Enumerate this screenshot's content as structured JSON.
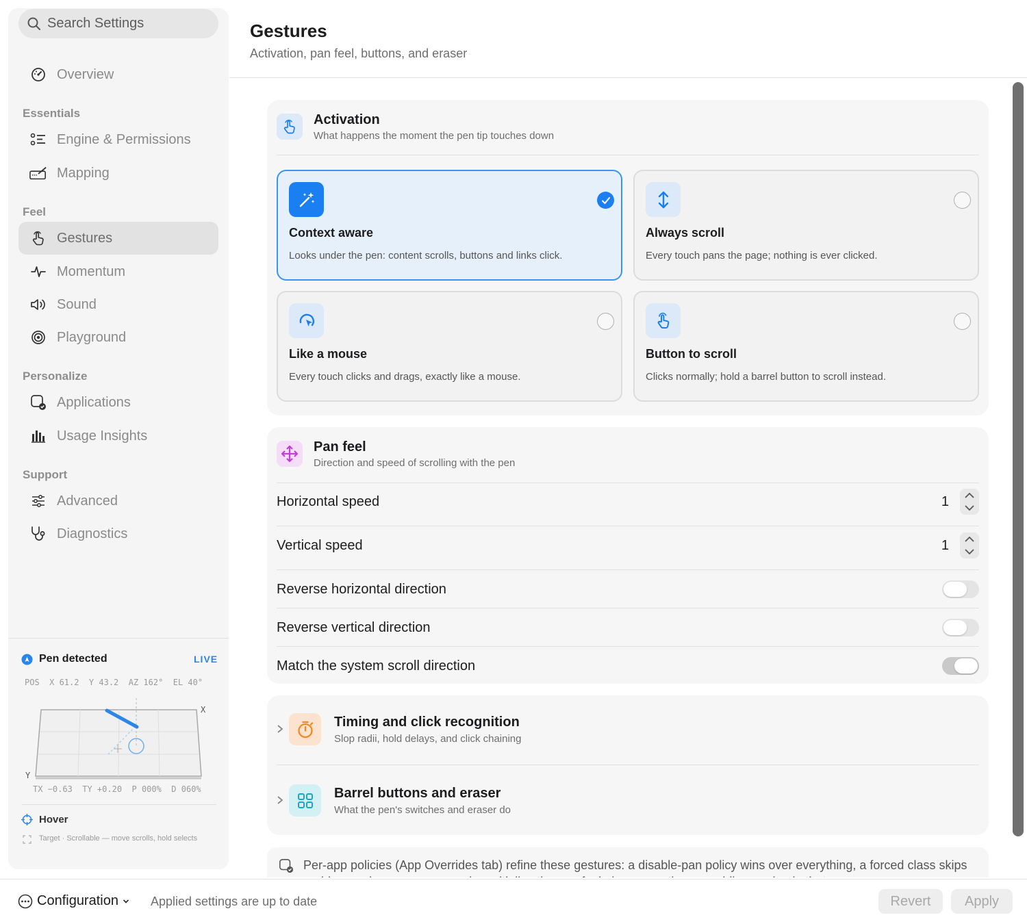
{
  "sidebar": {
    "search_placeholder": "Search Settings",
    "overview": "Overview",
    "sections": {
      "essentials": "Essentials",
      "feel": "Feel",
      "personalize": "Personalize",
      "support": "Support"
    },
    "items": {
      "engine": "Engine & Permissions",
      "mapping": "Mapping",
      "gestures": "Gestures",
      "momentum": "Momentum",
      "sound": "Sound",
      "playground": "Playground",
      "applications": "Applications",
      "usage": "Usage Insights",
      "advanced": "Advanced",
      "diagnostics": "Diagnostics"
    },
    "active_item": "Gestures"
  },
  "pen_panel": {
    "title": "Pen detected",
    "live": "LIVE",
    "readout_top": "POS  X 61.2  Y 43.2  AZ 162°  EL 40°",
    "readout_bottom": "TX −0.63  TY +0.20  P 000%  D 060%",
    "axis_x": "X",
    "axis_y": "Y",
    "hover_label": "Hover",
    "hover_target": "Target · Scrollable — move scrolls, hold selects"
  },
  "header": {
    "title": "Gestures",
    "subtitle": "Activation, pan feel, buttons, and eraser"
  },
  "activation": {
    "title": "Activation",
    "subtitle": "What happens the moment the pen tip touches down",
    "options": [
      {
        "title": "Context aware",
        "desc": "Looks under the pen: content scrolls, buttons and links click.",
        "selected": true
      },
      {
        "title": "Always scroll",
        "desc": "Every touch pans the page; nothing is ever clicked.",
        "selected": false
      },
      {
        "title": "Like a mouse",
        "desc": "Every touch clicks and drags, exactly like a mouse.",
        "selected": false
      },
      {
        "title": "Button to scroll",
        "desc": "Clicks normally; hold a barrel button to scroll instead.",
        "selected": false
      }
    ]
  },
  "pan_feel": {
    "title": "Pan feel",
    "subtitle": "Direction and speed of scrolling with the pen",
    "horizontal_speed": {
      "label": "Horizontal speed",
      "value": "1"
    },
    "vertical_speed": {
      "label": "Vertical speed",
      "value": "1"
    },
    "reverse_horizontal": {
      "label": "Reverse horizontal direction",
      "on": false
    },
    "reverse_vertical": {
      "label": "Reverse vertical direction",
      "on": false
    },
    "match_system": {
      "label": "Match the system scroll direction",
      "on": true
    }
  },
  "timing": {
    "title": "Timing and click recognition",
    "subtitle": "Slop radii, hold delays, and click chaining"
  },
  "barrel": {
    "title": "Barrel buttons and eraser",
    "subtitle": "What the pen's switches and eraser do"
  },
  "note": "Per-app policies (App Overrides tab) refine these gestures: a disable-pan policy wins over everything, a forced class skips probing, and a per-app pan gain multiplies the pan feel above exactly once while panning in that app.",
  "footer": {
    "config_label": "Configuration",
    "status": "Applied settings are up to date",
    "revert": "Revert",
    "apply": "Apply"
  },
  "colors": {
    "accent": "#1a7ff0",
    "selected_bg": "#e6f0fa",
    "pan_icon": "#c13fd6",
    "timing_icon": "#f08a24",
    "barrel_icon": "#1aa7c4"
  }
}
